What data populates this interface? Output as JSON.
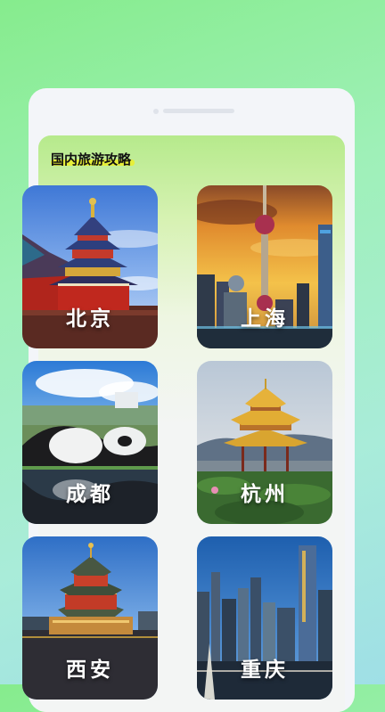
{
  "section": {
    "title": "国内旅游攻略"
  },
  "cities": [
    {
      "name": "北京"
    },
    {
      "name": "上海"
    },
    {
      "name": "成都"
    },
    {
      "name": "杭州"
    },
    {
      "name": "西安"
    },
    {
      "name": "重庆"
    }
  ],
  "colors": {
    "background": "#9fecb8",
    "title_highlight": "#e6ef3a",
    "card_label": "#ffffff"
  }
}
